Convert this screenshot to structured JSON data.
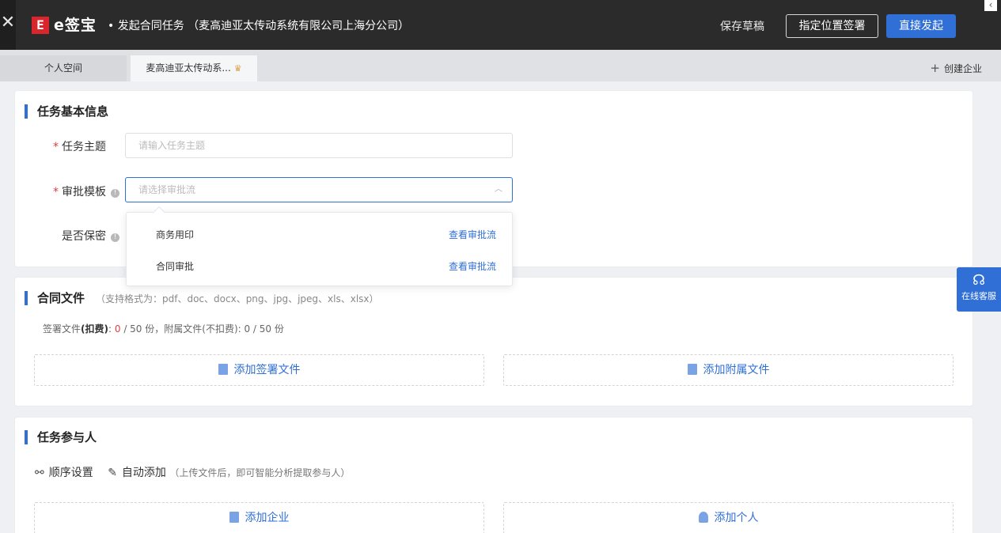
{
  "header": {
    "close_glyph": "✕",
    "logo_letter": "E",
    "brand": "e签宝",
    "title": "• 发起合同任务 （麦高迪亚太传动系统有限公司上海分公司）",
    "save_draft": "保存草稿",
    "specify_sign": "指定位置签署",
    "direct_start": "直接发起",
    "arrow": "‹"
  },
  "tabs": [
    {
      "label": "个人空间"
    },
    {
      "label": "麦高迪亚太传动系..."
    }
  ],
  "create_enterprise": "创建企业",
  "basic_info": {
    "title": "任务基本信息",
    "subject_label": "任务主题",
    "subject_placeholder": "请输入任务主题",
    "template_label": "审批模板",
    "template_placeholder": "请选择审批流",
    "confidential_label": "是否保密",
    "required_mark": "*",
    "dropdown": [
      {
        "name": "商务用印",
        "link": "查看审批流"
      },
      {
        "name": "合同审批",
        "link": "查看审批流"
      }
    ]
  },
  "contract_files": {
    "title": "合同文件",
    "hint": "（支持格式为：pdf、doc、docx、png、jpg、jpeg、xls、xlsx）",
    "sign_prefix": "签署文件",
    "sign_bold": "(扣费)",
    "sign_count": "0",
    "sign_total": " / 50 份，附属文件(不扣费): 0 / 50 份",
    "add_sign": "添加签署文件",
    "add_attach": "添加附属文件"
  },
  "participants": {
    "title": "任务参与人",
    "order_setting": "顺序设置",
    "auto_add": "自动添加",
    "auto_hint": "（上传文件后，即可智能分析提取参与人）",
    "add_enterprise": "添加企业",
    "add_person": "添加个人"
  },
  "online_service": "在线客服",
  "colors": {
    "accent": "#2f6fd6",
    "brand_red": "#d9262c",
    "required": "#e23c3c"
  }
}
